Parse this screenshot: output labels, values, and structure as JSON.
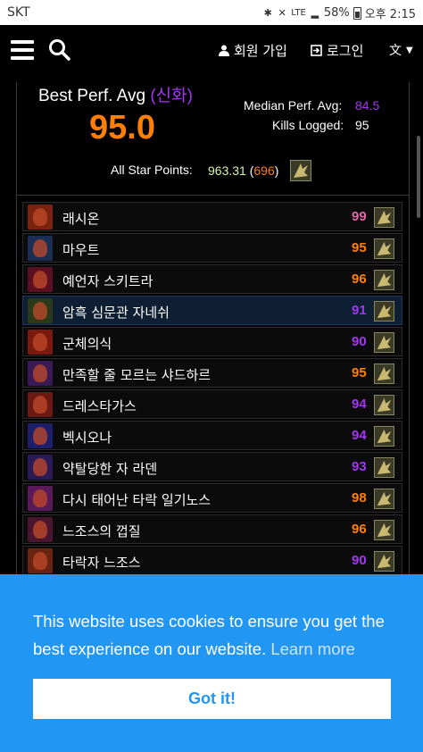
{
  "status_bar": {
    "carrier": "SKT",
    "network": "LTE",
    "battery": "58%",
    "time": "오후 2:15"
  },
  "nav": {
    "signup_label": "회원 가입",
    "login_label": "로그인",
    "menu_icon": "hamburger-icon",
    "search_icon": "search-icon",
    "language_icon": "translate-icon"
  },
  "summary": {
    "best_perf_label": "Best Perf. Avg",
    "difficulty": "(신화)",
    "best_perf_value": "95.0",
    "median_label": "Median Perf. Avg:",
    "median_value": "84.5",
    "kills_label": "Kills Logged:",
    "kills_value": "95",
    "all_star_label": "All Star Points:",
    "all_star_points": "963.31",
    "all_star_rank_open": " (",
    "all_star_rank": "696",
    "all_star_rank_close": ")"
  },
  "bosses": [
    {
      "name": "래시온",
      "score": "99",
      "tier": "astounding",
      "thumb": "#7a2410"
    },
    {
      "name": "마우트",
      "score": "95",
      "tier": "legendary",
      "thumb": "#1b2f55"
    },
    {
      "name": "예언자 스키트라",
      "score": "96",
      "tier": "legendary",
      "thumb": "#5a1020"
    },
    {
      "name": "암흑 심문관 자네쉬",
      "score": "91",
      "tier": "epic",
      "thumb": "#2a3a1a"
    },
    {
      "name": "군체의식",
      "score": "90",
      "tier": "epic",
      "thumb": "#7a1a0e"
    },
    {
      "name": "만족할 줄 모르는 샤드하르",
      "score": "95",
      "tier": "legendary",
      "thumb": "#3a1a55"
    },
    {
      "name": "드레스타가스",
      "score": "94",
      "tier": "epic",
      "thumb": "#6a1a12"
    },
    {
      "name": "벡시오나",
      "score": "94",
      "tier": "epic",
      "thumb": "#1e1f6a"
    },
    {
      "name": "약탈당한 자 라덴",
      "score": "93",
      "tier": "epic",
      "thumb": "#2a1a55"
    },
    {
      "name": "다시 태어난 타락 일기노스",
      "score": "98",
      "tier": "legendary",
      "thumb": "#5a1a5a"
    },
    {
      "name": "느조스의 껍질",
      "score": "96",
      "tier": "legendary",
      "thumb": "#4a1530"
    },
    {
      "name": "타락자 느조스",
      "score": "90",
      "tier": "epic",
      "thumb": "#6a2410"
    }
  ],
  "tier_colors": {
    "astounding": "#e268a8",
    "legendary": "#ff8000",
    "epic": "#a335ee"
  },
  "cookie": {
    "message": "This website uses cookies to ensure you get the best experience on our website.",
    "learn_more": "Learn more",
    "accept": "Got it!"
  }
}
